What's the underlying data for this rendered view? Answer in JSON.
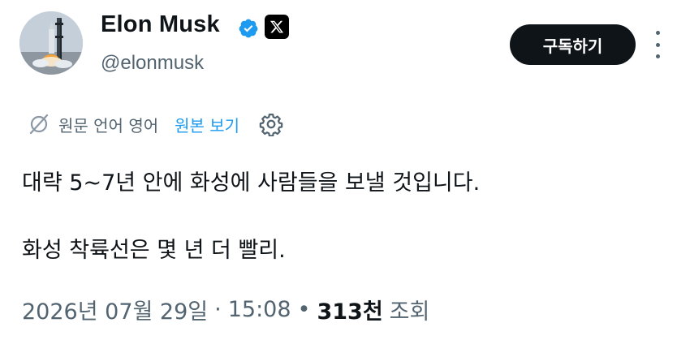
{
  "author": {
    "name": "Elon Musk",
    "handle": "@elonmusk",
    "verified_color": "#1d9bf0",
    "affiliate_badge": "x-logo-icon"
  },
  "actions": {
    "subscribe_label": "구독하기",
    "more_icon": "more-vertical-icon"
  },
  "translation": {
    "info": "원문 언어 영어",
    "view_original": "원본 보기",
    "settings_icon": "gear-icon"
  },
  "post": {
    "line1": "대략 5~7년 안에 화성에 사람들을 보낼 것입니다.",
    "line2": "화성 착륙선은 몇 년 더 빨리."
  },
  "meta": {
    "date": "2026년 07월 29일",
    "time": "15:08",
    "separator": "·",
    "views_count": "313천",
    "views_label": "조회"
  },
  "colors": {
    "text": "#0f1419",
    "secondary": "#536471",
    "link": "#1d9bf0",
    "button_bg": "#0f1419"
  }
}
